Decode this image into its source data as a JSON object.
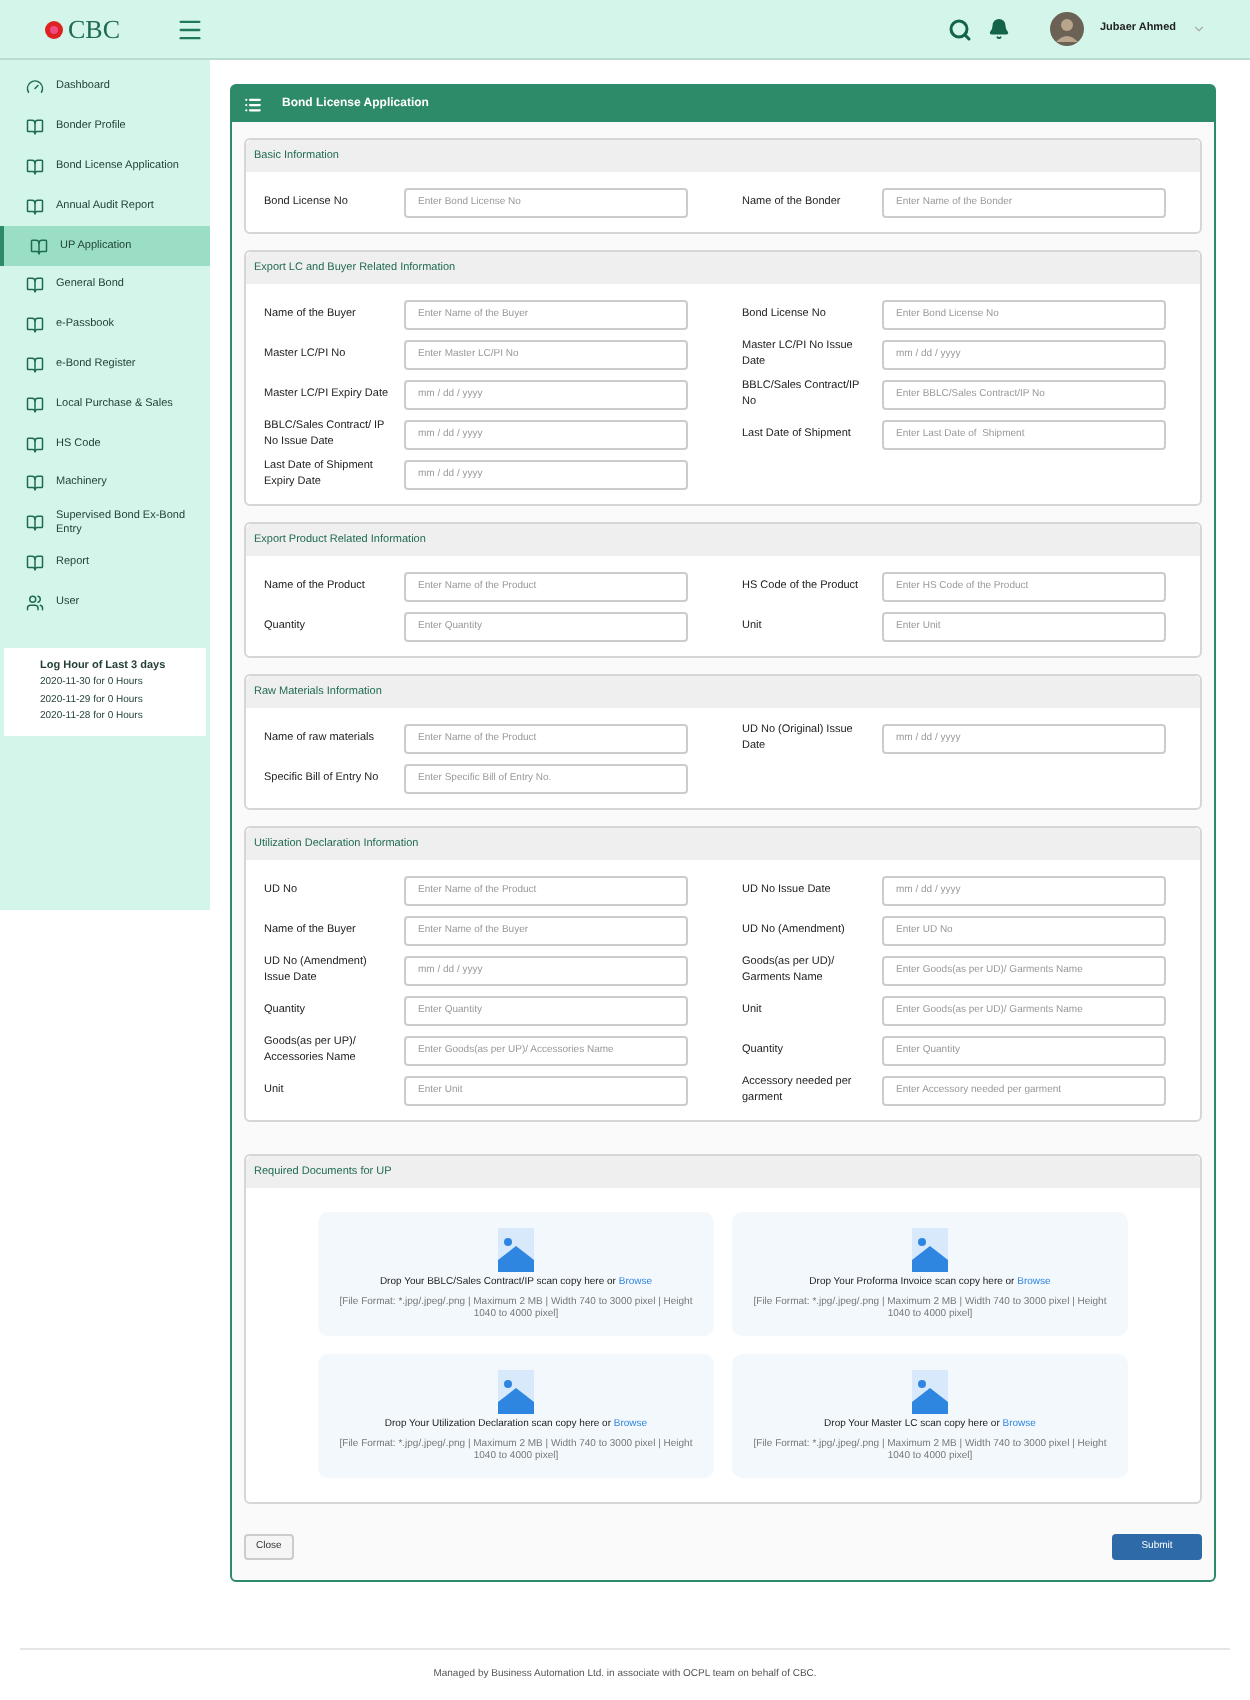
{
  "header": {
    "logo": "CBC",
    "user": "Jubaer Ahmed"
  },
  "sidebar": {
    "items": [
      {
        "label": "Dashboard",
        "kind": "dashboard",
        "selected": false
      },
      {
        "label": "Bonder Profile",
        "kind": "book",
        "selected": false
      },
      {
        "label": "Bond License Application",
        "kind": "book",
        "selected": false
      },
      {
        "label": "Annual Audit Report",
        "kind": "book",
        "selected": false
      },
      {
        "label": "UP Application",
        "kind": "book",
        "selected": true
      },
      {
        "label": "General Bond",
        "kind": "book",
        "selected": false
      },
      {
        "label": "e-Passbook",
        "kind": "book",
        "selected": false
      },
      {
        "label": "e-Bond Register",
        "kind": "book",
        "selected": false
      },
      {
        "label": "Local Purchase & Sales",
        "kind": "book",
        "selected": false
      },
      {
        "label": "HS Code",
        "kind": "book",
        "selected": false
      },
      {
        "label": "Machinery",
        "kind": "book",
        "selected": false
      },
      {
        "label": "Supervised Bond Ex-Bond Entry",
        "kind": "book",
        "selected": false
      },
      {
        "label": "Report",
        "kind": "book",
        "selected": false
      },
      {
        "label": "User",
        "kind": "users",
        "selected": false
      }
    ],
    "log": {
      "title": "Log Hour of Last 3 days",
      "entries": [
        "2020-11-30 for 0 Hours",
        "2020-11-29 for 0 Hours",
        "2020-11-28 for 0 Hours"
      ]
    }
  },
  "card": {
    "title": "Bond License Application",
    "sections": [
      {
        "title": "Basic Information",
        "rows": [
          {
            "left": {
              "label": "Bond License No",
              "placeholder": "Enter Bond License No"
            },
            "right": {
              "label": "Name of the Bonder",
              "placeholder": "Enter Name of the Bonder"
            }
          }
        ]
      },
      {
        "title": "Export LC and Buyer Related Information",
        "rows": [
          {
            "left": {
              "label": "Name of the Buyer",
              "placeholder": "Enter Name of the Buyer"
            },
            "right": {
              "label": "Bond License No",
              "placeholder": "Enter Bond License No"
            }
          },
          {
            "left": {
              "label": "Master LC/PI No",
              "placeholder": "Enter Master LC/PI No"
            },
            "right": {
              "label": "Master LC/PI No Issue Date",
              "placeholder": "mm / dd / yyyy"
            }
          },
          {
            "left": {
              "label": "Master LC/PI Expiry Date",
              "placeholder": "mm / dd / yyyy"
            },
            "right": {
              "label": "BBLC/Sales Contract/IP No",
              "placeholder": "Enter BBLC/Sales Contract/IP No"
            }
          },
          {
            "left": {
              "label": "BBLC/Sales Contract/ IP No Issue Date",
              "placeholder": "mm / dd / yyyy"
            },
            "right": {
              "label": "Last Date of Shipment",
              "placeholder": "Enter Last Date of  Shipment"
            }
          },
          {
            "left": {
              "label": "Last Date of Shipment Expiry Date",
              "placeholder": "mm / dd / yyyy"
            }
          }
        ]
      },
      {
        "title": "Export Product Related Information",
        "rows": [
          {
            "left": {
              "label": "Name of the Product",
              "placeholder": "Enter Name of the Product"
            },
            "right": {
              "label": "HS Code of the Product",
              "placeholder": "Enter HS Code of the Product"
            }
          },
          {
            "left": {
              "label": "Quantity",
              "placeholder": "Enter Quantity"
            },
            "right": {
              "label": "Unit",
              "placeholder": "Enter Unit"
            }
          }
        ]
      },
      {
        "title": "Raw Materials Information",
        "rows": [
          {
            "left": {
              "label": "Name of raw materials",
              "placeholder": "Enter Name of the Product"
            },
            "right": {
              "label": "UD No (Original) Issue Date",
              "placeholder": "mm / dd / yyyy"
            }
          },
          {
            "left": {
              "label": "Specific Bill of Entry No",
              "placeholder": "Enter Specific Bill of Entry No."
            }
          }
        ]
      },
      {
        "title": "Utilization Declaration Information",
        "rows": [
          {
            "left": {
              "label": "UD No",
              "placeholder": "Enter Name of the Product"
            },
            "right": {
              "label": "UD No Issue Date",
              "placeholder": "mm / dd / yyyy"
            }
          },
          {
            "left": {
              "label": "Name of the Buyer",
              "placeholder": "Enter Name of the Buyer"
            },
            "right": {
              "label": "UD No (Amendment)",
              "placeholder": "Enter UD No"
            }
          },
          {
            "left": {
              "label": "UD No (Amendment) Issue Date",
              "placeholder": "mm / dd / yyyy"
            },
            "right": {
              "label": "Goods(as per UD)/ Garments Name",
              "placeholder": "Enter Goods(as per UD)/ Garments Name"
            }
          },
          {
            "left": {
              "label": "Quantity",
              "placeholder": "Enter Quantity"
            },
            "right": {
              "label": "Unit",
              "placeholder": "Enter Goods(as per UD)/ Garments Name"
            }
          },
          {
            "left": {
              "label": "Goods(as per UP)/ Accessories Name",
              "placeholder": "Enter Goods(as per UP)/ Accessories Name"
            },
            "right": {
              "label": "Quantity",
              "placeholder": "Enter Quantity"
            }
          },
          {
            "left": {
              "label": "Unit",
              "placeholder": "Enter Unit"
            },
            "right": {
              "label": "Accessory needed per garment",
              "placeholder": "Enter Accessory needed per garment"
            }
          }
        ]
      }
    ],
    "documents": {
      "title": "Required Documents for UP",
      "items": [
        {
          "text": "Drop Your BBLC/Sales Contract/IP scan copy here or",
          "link": "Browse",
          "note": "[File Format: *.jpg/.jpeg/.png | Maximum 2 MB | Width 740 to 3000 pixel | Height 1040 to 4000 pixel]"
        },
        {
          "text": "Drop Your Proforma Invoice scan copy here or",
          "link": "Browse",
          "note": "[File Format: *.jpg/.jpeg/.png | Maximum 2 MB | Width 740 to 3000 pixel | Height 1040 to 4000 pixel]"
        },
        {
          "text": "Drop Your Utilization Declaration scan copy here or",
          "link": "Browse",
          "note": "[File Format: *.jpg/.jpeg/.png | Maximum 2 MB | Width 740 to 3000 pixel | Height 1040 to 4000 pixel]"
        },
        {
          "text": "Drop Your Master LC scan copy here or",
          "link": "Browse",
          "note": "[File Format: *.jpg/.jpeg/.png | Maximum 2 MB | Width 740 to 3000 pixel | Height 1040 to 4000 pixel]"
        }
      ]
    },
    "buttons": {
      "close": "Close",
      "submit": "Submit"
    }
  },
  "footer": "Managed by Business Automation Ltd. in associate with OCPL team on behalf of CBC."
}
